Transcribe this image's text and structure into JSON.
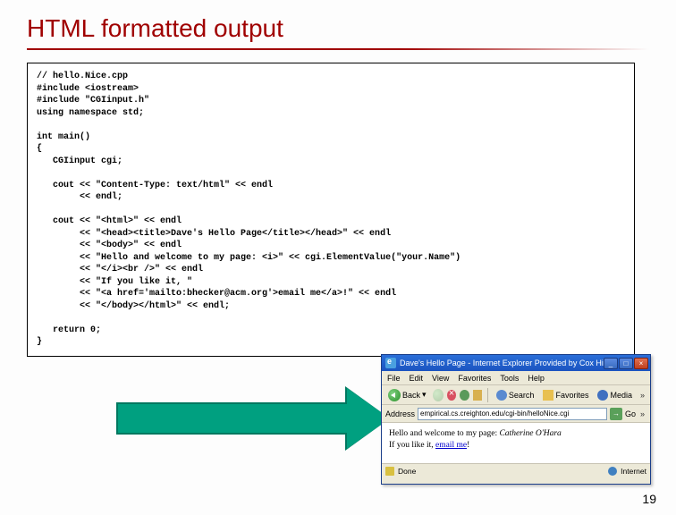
{
  "slide": {
    "title": "HTML formatted output",
    "page_number": "19"
  },
  "code": {
    "l01": "// hello.Nice.cpp",
    "l02": "#include <iostream>",
    "l03": "#include \"CGIinput.h\"",
    "l04": "using namespace std;",
    "l05": "",
    "l06": "int main()",
    "l07": "{",
    "l08": "   CGIinput cgi;",
    "l09": "",
    "l10": "   cout << \"Content-Type: text/html\" << endl",
    "l11": "        << endl;",
    "l12": "",
    "l13": "   cout << \"<html>\" << endl",
    "l14": "        << \"<head><title>Dave's Hello Page</title></head>\" << endl",
    "l15": "        << \"<body>\" << endl",
    "l16": "        << \"Hello and welcome to my page: <i>\" << cgi.ElementValue(\"your.Name\")",
    "l17": "        << \"</i><br />\" << endl",
    "l18": "        << \"If you like it, \"",
    "l19": "        << \"<a href='mailto:bhecker@acm.org'>email me</a>!\" << endl",
    "l20": "        << \"</body></html>\" << endl;",
    "l21": "",
    "l22": "   return 0;",
    "l23": "}"
  },
  "browser": {
    "window_title": "Dave's Hello Page - Internet Explorer Provided by Cox High ...",
    "menu": {
      "file": "File",
      "edit": "Edit",
      "view": "View",
      "favorites": "Favorites",
      "tools": "Tools",
      "help": "Help"
    },
    "toolbar": {
      "back": "Back",
      "search": "Search",
      "favorites": "Favorites",
      "media": "Media"
    },
    "address_label": "Address",
    "address_value": "empirical.cs.creighton.edu/cgi-bin/helloNice.cgi",
    "go": "Go",
    "content_line1_prefix": "Hello and welcome to my page: ",
    "content_line1_name": "Catherine O'Hara",
    "content_line2_prefix": "If you like it, ",
    "content_line2_link": "email me",
    "content_line2_suffix": "!",
    "status_done": "Done",
    "status_zone": "Internet"
  }
}
